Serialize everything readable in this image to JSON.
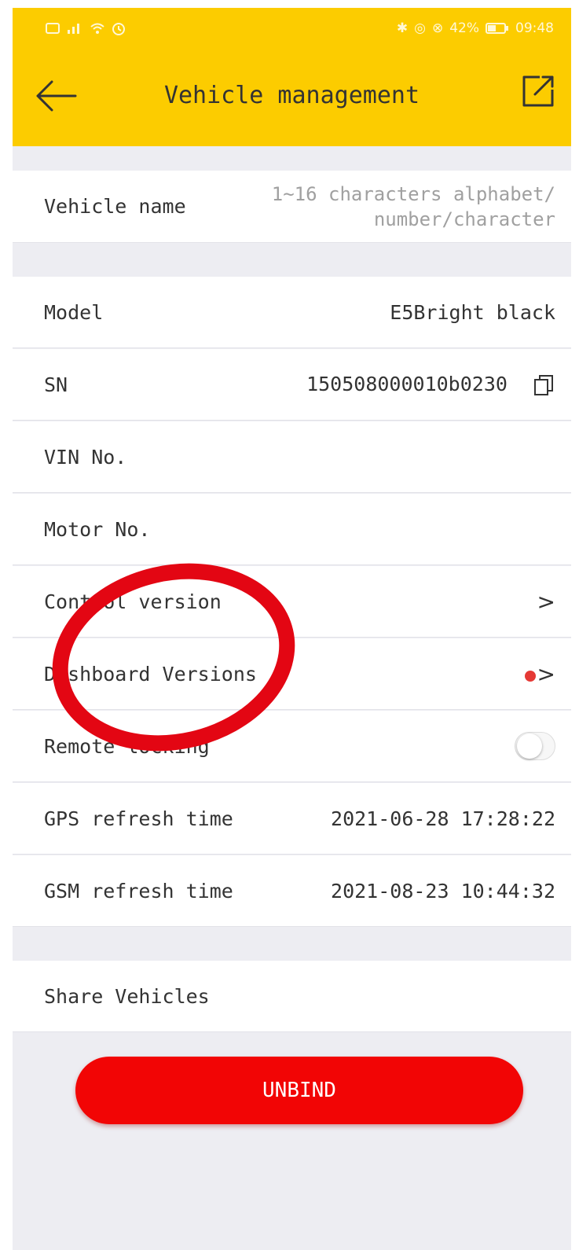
{
  "status_bar": {
    "left_icons": [
      "sim-icon",
      "signal-icon",
      "wifi-icon",
      "alarm-icon"
    ],
    "battery": "42%",
    "time": "09:48"
  },
  "header": {
    "title": "Vehicle management",
    "back_icon": "arrow-left-icon",
    "share_icon": "share-icon"
  },
  "vehicle_name": {
    "label": "Vehicle name",
    "placeholder_line1": "1~16 characters alphabet/",
    "placeholder_line2": "number/character"
  },
  "details": {
    "model": {
      "label": "Model",
      "value": "E5Bright black"
    },
    "sn": {
      "label": "SN",
      "value": "150508000010b0230"
    },
    "vin": {
      "label": "VIN No.",
      "value": ""
    },
    "motor": {
      "label": "Motor No.",
      "value": ""
    },
    "control": {
      "label": "Control version",
      "chevron": ">"
    },
    "dashboard": {
      "label": "Dashboard Versions",
      "chevron": ">"
    },
    "remote_locking": {
      "label": "Remote locking",
      "toggled": false
    },
    "gps": {
      "label": "GPS refresh time",
      "value": "2021-06-28 17:28:22"
    },
    "gsm": {
      "label": "GSM refresh time",
      "value": "2021-08-23 10:44:32"
    }
  },
  "share": {
    "label": "Share Vehicles"
  },
  "unbind_button": {
    "label": "UNBIND"
  },
  "colors": {
    "header": "#fccc00",
    "unbind": "#f20505",
    "annotation": "#e30613",
    "badge_dot": "#e53935"
  }
}
